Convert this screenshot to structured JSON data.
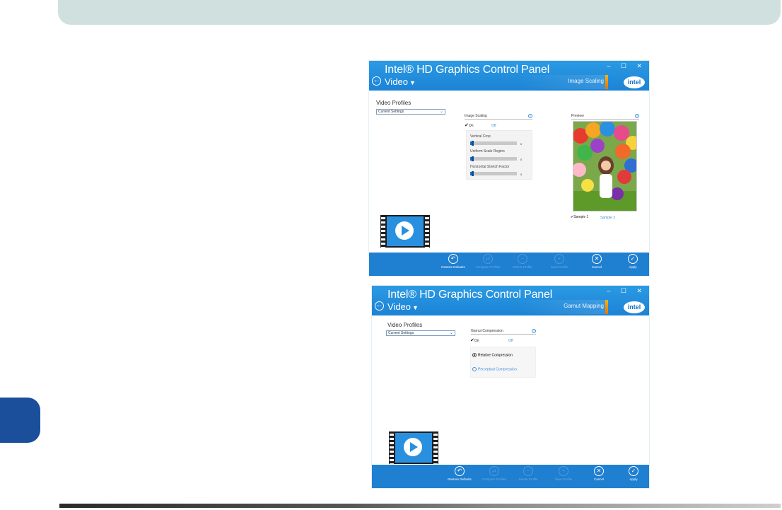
{
  "panels": [
    {
      "title": "Intel® HD Graphics Control Panel",
      "section": "Video",
      "crumb": "Image Scaling",
      "logo": "intel",
      "window_controls": "– ☐ ✕",
      "profiles_label": "Video Profiles",
      "profiles_value": "Current Settings",
      "group_title": "Image Scaling",
      "toggle_on": "On",
      "toggle_off": "Off",
      "sliders": [
        {
          "label": "Vertical Crop",
          "value": "0",
          "level": 0
        },
        {
          "label": "Uniform Scale Region",
          "value": "0",
          "level": 0
        },
        {
          "label": "Horizontal Stretch Factor",
          "value": "0",
          "level": 0
        }
      ],
      "preview_label": "Preview",
      "sample1": "Sample 1",
      "sample2": "Sample 2",
      "buttons": [
        {
          "label": "Restore Defaults",
          "icon": "undo-icon",
          "enabled": true
        },
        {
          "label": "Compare Profiles",
          "icon": "compare-icon",
          "enabled": false
        },
        {
          "label": "Delete Profile",
          "icon": "delete-icon",
          "enabled": false
        },
        {
          "label": "Save Profile",
          "icon": "save-icon",
          "enabled": false
        },
        {
          "label": "Cancel",
          "icon": "cancel-icon",
          "enabled": true
        },
        {
          "label": "Apply",
          "icon": "apply-icon",
          "enabled": true
        }
      ]
    },
    {
      "title": "Intel® HD Graphics Control Panel",
      "section": "Video",
      "crumb": "Gamut Mapping",
      "logo": "intel",
      "window_controls": "– ☐ ✕",
      "profiles_label": "Video Profiles",
      "profiles_value": "Current Settings",
      "group_title": "Gamut Compression",
      "toggle_on": "On",
      "toggle_off": "Off",
      "radios": [
        {
          "label": "Relative Compression",
          "selected": true
        },
        {
          "label": "Perceptual Compression",
          "selected": false
        }
      ],
      "buttons": [
        {
          "label": "Restore Defaults",
          "icon": "undo-icon",
          "enabled": true
        },
        {
          "label": "Compare Profiles",
          "icon": "compare-icon",
          "enabled": false
        },
        {
          "label": "Delete Profile",
          "icon": "delete-icon",
          "enabled": false
        },
        {
          "label": "Save Profile",
          "icon": "save-icon",
          "enabled": false
        },
        {
          "label": "Cancel",
          "icon": "cancel-icon",
          "enabled": true
        },
        {
          "label": "Apply",
          "icon": "apply-icon",
          "enabled": true
        }
      ]
    }
  ],
  "colors": {
    "accent": "#1f7fd1",
    "title_bar": "#2b9ae3",
    "link": "#3d8ee0",
    "chapter_tab": "#1b4f9c",
    "banner": "#cfe0df"
  }
}
